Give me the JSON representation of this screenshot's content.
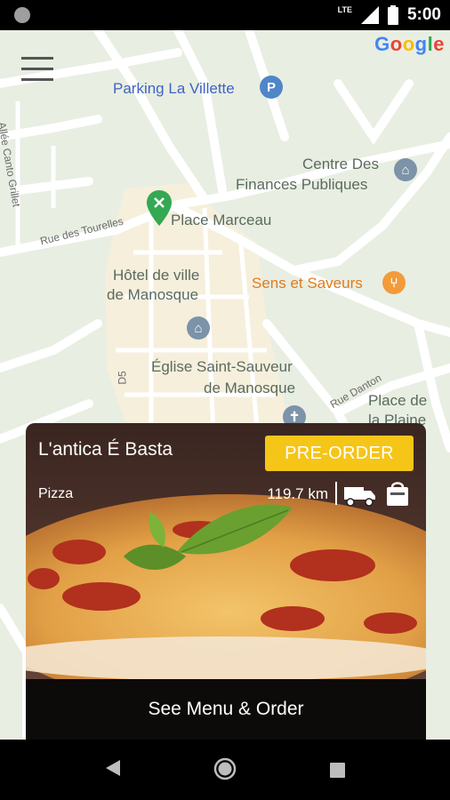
{
  "status_bar": {
    "network": "LTE",
    "time": "5:00"
  },
  "map": {
    "attribution": "Google",
    "labels": {
      "parking": "Parking La Villette",
      "centre_des": "Centre Des",
      "finances": "Finances Publiques",
      "place_marceau": "Place Marceau",
      "hotel_de_ville": "Hôtel de ville",
      "de_manosque": "de Manosque",
      "sens_et_saveurs": "Sens et Saveurs",
      "eglise": "Église Saint-Sauveur",
      "eglise_2": "de Manosque",
      "place_de": "Place de",
      "la_plaine": "la Plaine",
      "rue_tourelles": "Rue des Tourelles",
      "rue_danton": "Rue Danton",
      "allee": "Allée Canto Grillet",
      "d5": "D5"
    }
  },
  "restaurant": {
    "name": "L'antica É Basta",
    "preorder_label": "PRE-ORDER",
    "category": "Pizza",
    "distance": "119.7 km",
    "cta_label": "See Menu & Order"
  },
  "colors": {
    "accent": "#f5c518",
    "pin_green": "#34a853",
    "poi_orange": "#f29b3a",
    "poi_blue": "#4f86c8"
  }
}
